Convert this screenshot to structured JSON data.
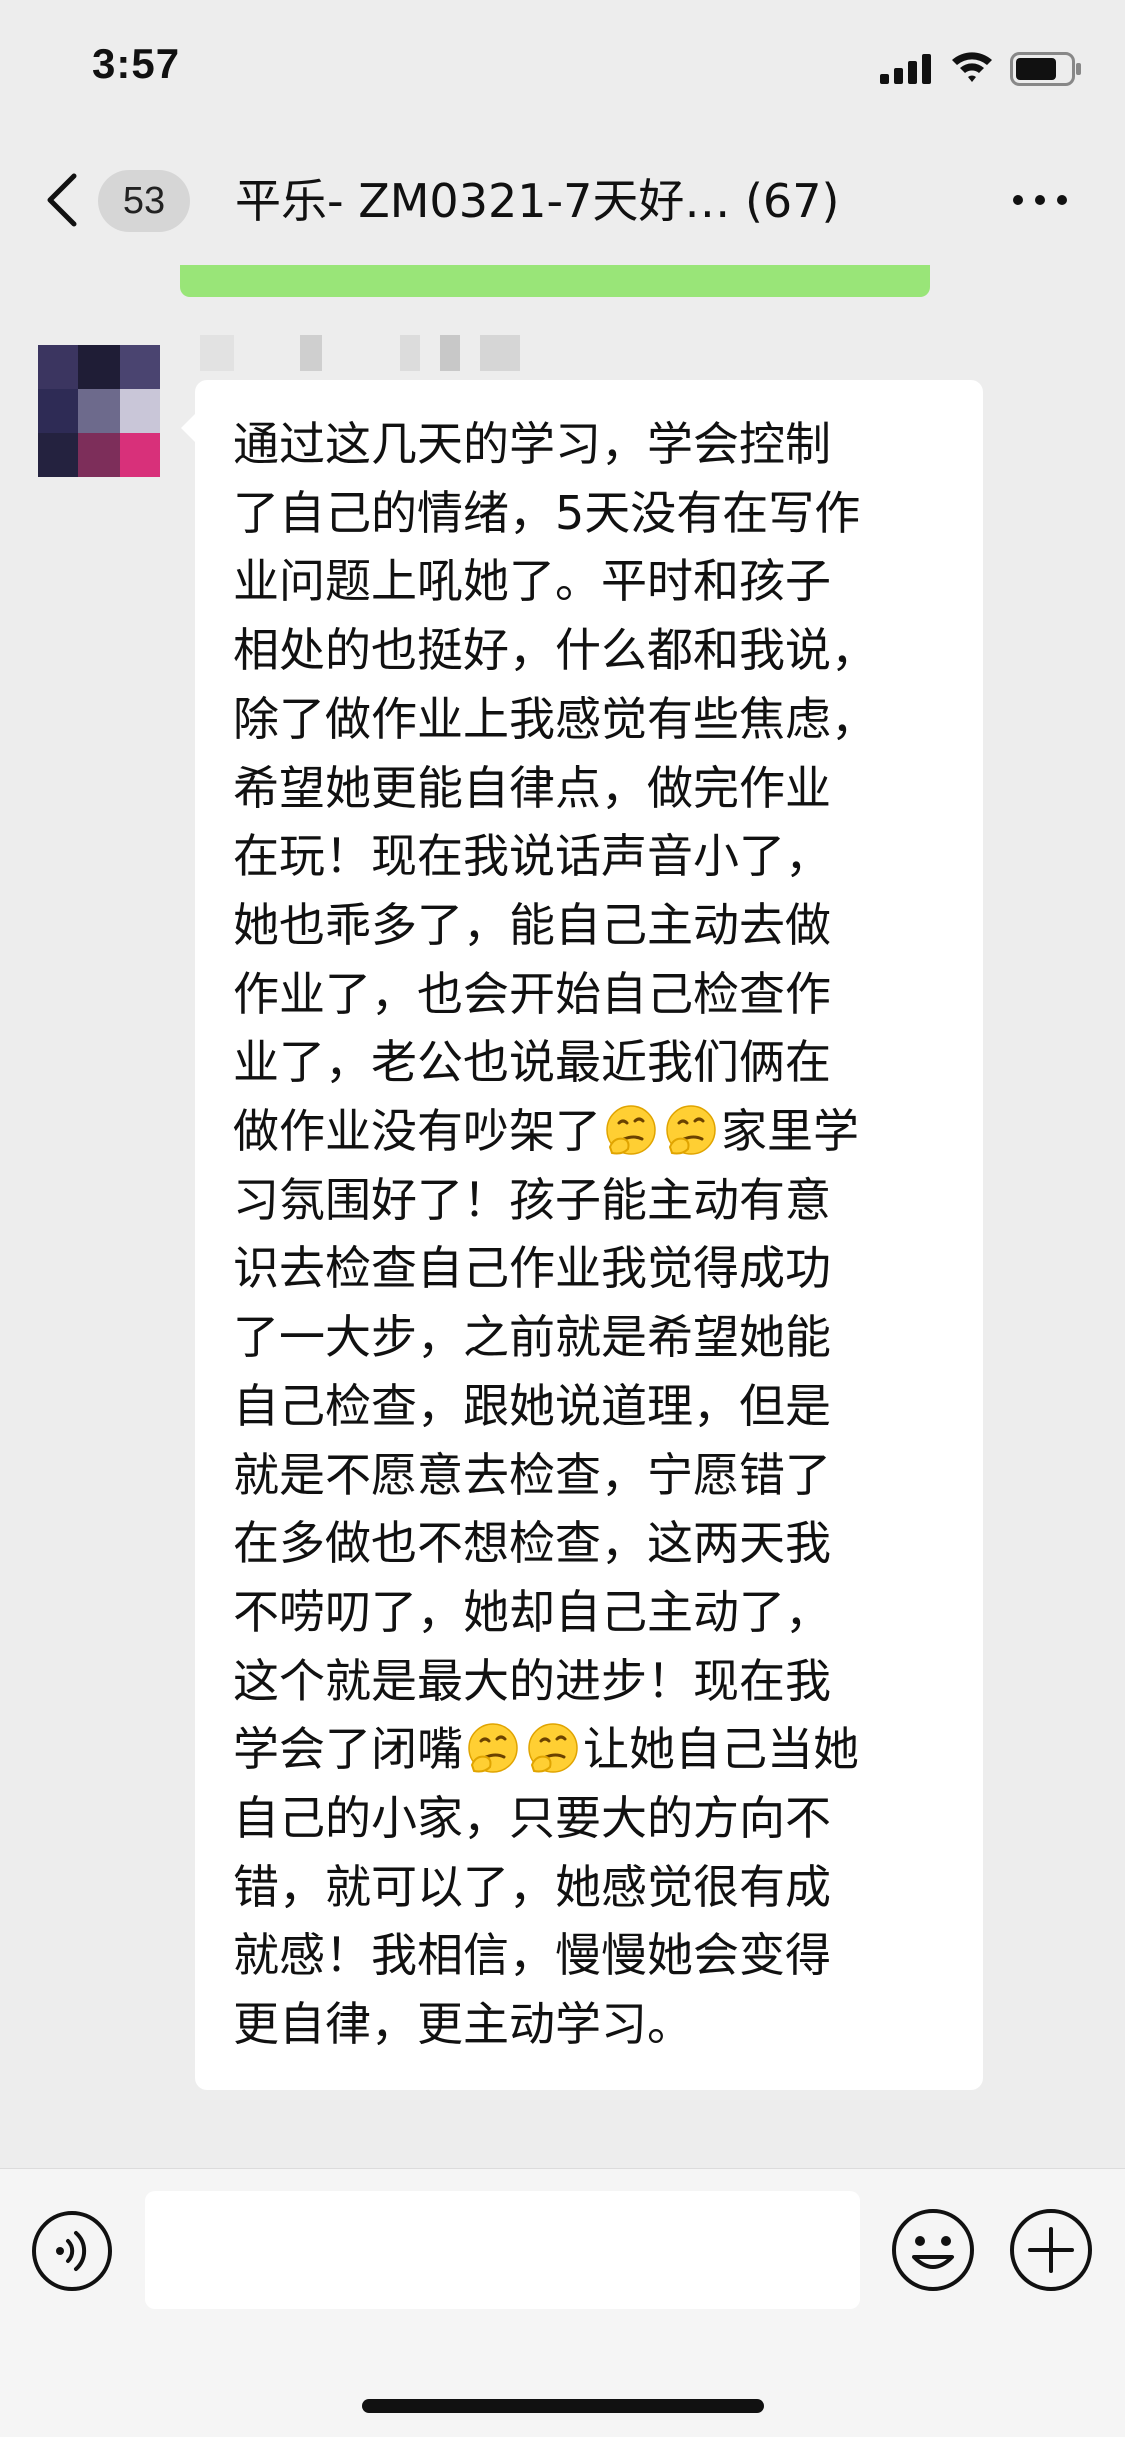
{
  "status_bar": {
    "time": "3:57",
    "battery_level": 0.75
  },
  "nav": {
    "unread_badge": "53",
    "title": "平乐- ZM0321-7天好…  (67)"
  },
  "message": {
    "lines": [
      "通过这几天的学习，学会控制",
      "了自己的情绪，5天没有在写作",
      "业问题上吼她了。平时和孩子",
      "相处的也挺好，什么都和我说，",
      "除了做作业上我感觉有些焦虑，",
      "希望她更能自律点，做完作业",
      "在玩！现在我说话声音小了，",
      "她也乖多了，能自己主动去做",
      "作业了，也会开始自己检查作",
      "业了，老公也说最近我们俩在",
      "做作业没有吵架了",
      "习氛围好了！孩子能主动有意",
      "识去检查自己作业我觉得成功",
      "了一大步，之前就是希望她能",
      "自己检查，跟她说道理，但是",
      "就是不愿意去检查，宁愿错了",
      "在多做也不想检查，这两天我",
      "不唠叨了，她却自己主动了，",
      "这个就是最大的进步！现在我",
      "学会了闭嘴",
      "自己的小家，只要大的方向不",
      "错，就可以了，她感觉很有成",
      "就感！我相信，慢慢她会变得",
      "更自律，更主动学习。"
    ],
    "line_11_suffix": "家里学",
    "line_20_suffix": "让她自己当她",
    "emoji_name": "thinking-face-emoji"
  },
  "input": {
    "placeholder": ""
  },
  "colors": {
    "background": "#ededed",
    "bubble": "#ffffff",
    "accent_green": "#8fe36a"
  }
}
